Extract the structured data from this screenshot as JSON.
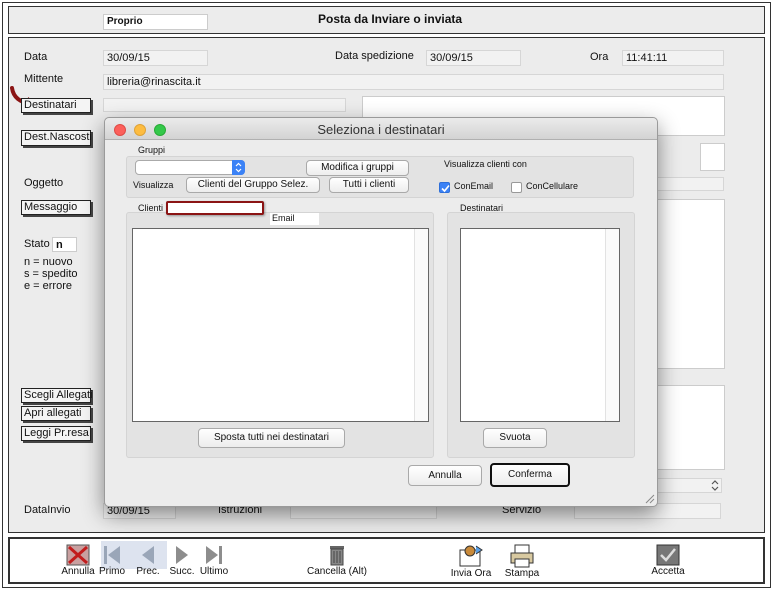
{
  "header": {
    "type_value": "Proprio",
    "title": "Posta da Inviare o inviata"
  },
  "form": {
    "data_label": "Data",
    "data_value": "30/09/15",
    "data_spedizione_label": "Data spedizione",
    "data_spedizione_value": "30/09/15",
    "ora_label": "Ora",
    "ora_value": "11:41:11",
    "mittente_label": "Mittente",
    "mittente_value": "libreria@rinascita.it",
    "destinatari_button": "Destinatari",
    "dest_nascosti_button": "Dest.Nascosti",
    "oggetto_label": "Oggetto",
    "messaggio_button": "Messaggio",
    "stato_label": "Stato",
    "stato_value": "n",
    "legend_nuovo": "n = nuovo",
    "legend_spedito": "s = spedito",
    "legend_errore": "e = errore",
    "scegli_allegati_button": "Scegli Allegati",
    "apri_allegati_button": "Apri allegati",
    "leggi_prresa_button": "Leggi Pr.resa",
    "datainvio_label": "DataInvio",
    "datainvio_value": "30/09/15",
    "istruzioni_label": "Istruzioni",
    "servizio_label": "Servizio"
  },
  "dialog": {
    "title": "Seleziona i destinatari",
    "gruppi_label": "Gruppi",
    "gruppi_select_value": "",
    "modifica_gruppi_button": "Modifica i gruppi",
    "visualizza_label": "Visualizza",
    "clienti_gruppo_button": "Clienti del Gruppo Selez.",
    "tutti_clienti_button": "Tutti i clienti",
    "visualizza_clienti_con_label": "Visualizza clienti con",
    "conemail_label": "ConEmail",
    "conemail_checked": true,
    "concellulare_label": "ConCellulare",
    "concellulare_checked": false,
    "clienti_label": "Clienti",
    "email_label": "Email",
    "destinatari_label": "Destinatari",
    "sposta_button": "Sposta tutti nei destinatari",
    "svuota_button": "Svuota",
    "annulla_button": "Annulla",
    "conferma_button": "Conferma"
  },
  "toolbar": {
    "annulla": "Annulla",
    "primo": "Primo",
    "prec": "Prec.",
    "succ": "Succ.",
    "ultimo": "Ultimo",
    "cancella": "Cancella (Alt)",
    "invia_ora": "Invia Ora",
    "stampa": "Stampa",
    "accetta": "Accetta"
  },
  "colors": {
    "annotation_red": "#8b1414",
    "accent_blue": "#3b82f6",
    "window_bg": "#ececec"
  }
}
